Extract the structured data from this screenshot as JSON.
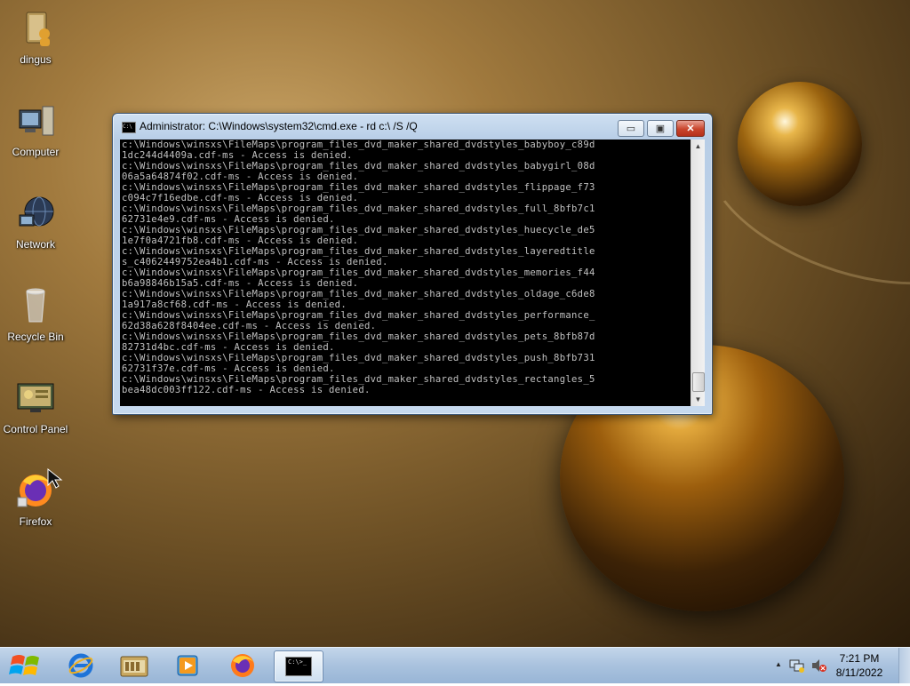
{
  "window": {
    "title": "Administrator: C:\\Windows\\system32\\cmd.exe - rd  c:\\ /S /Q",
    "icon_text": "C:\\",
    "min_symbol": "▭",
    "max_symbol": "▣",
    "close_symbol": "✕"
  },
  "console_lines": [
    "c:\\Windows\\winsxs\\FileMaps\\program_files_dvd_maker_shared_dvdstyles_babyboy_c89d",
    "1dc244d4409a.cdf-ms - Access is denied.",
    "c:\\Windows\\winsxs\\FileMaps\\program_files_dvd_maker_shared_dvdstyles_babygirl_08d",
    "06a5a64874f02.cdf-ms - Access is denied.",
    "c:\\Windows\\winsxs\\FileMaps\\program_files_dvd_maker_shared_dvdstyles_flippage_f73",
    "c094c7f16edbe.cdf-ms - Access is denied.",
    "c:\\Windows\\winsxs\\FileMaps\\program_files_dvd_maker_shared_dvdstyles_full_8bfb7c1",
    "62731e4e9.cdf-ms - Access is denied.",
    "c:\\Windows\\winsxs\\FileMaps\\program_files_dvd_maker_shared_dvdstyles_huecycle_de5",
    "1e7f0a4721fb8.cdf-ms - Access is denied.",
    "c:\\Windows\\winsxs\\FileMaps\\program_files_dvd_maker_shared_dvdstyles_layeredtitle",
    "s_c4062449752ea4b1.cdf-ms - Access is denied.",
    "c:\\Windows\\winsxs\\FileMaps\\program_files_dvd_maker_shared_dvdstyles_memories_f44",
    "b6a98846b15a5.cdf-ms - Access is denied.",
    "c:\\Windows\\winsxs\\FileMaps\\program_files_dvd_maker_shared_dvdstyles_oldage_c6de8",
    "1a917a8cf68.cdf-ms - Access is denied.",
    "c:\\Windows\\winsxs\\FileMaps\\program_files_dvd_maker_shared_dvdstyles_performance_",
    "62d38a628f8404ee.cdf-ms - Access is denied.",
    "c:\\Windows\\winsxs\\FileMaps\\program_files_dvd_maker_shared_dvdstyles_pets_8bfb87d",
    "82731d4bc.cdf-ms - Access is denied.",
    "c:\\Windows\\winsxs\\FileMaps\\program_files_dvd_maker_shared_dvdstyles_push_8bfb731",
    "62731f37e.cdf-ms - Access is denied.",
    "c:\\Windows\\winsxs\\FileMaps\\program_files_dvd_maker_shared_dvdstyles_rectangles_5",
    "bea48dc003ff122.cdf-ms - Access is denied."
  ],
  "desktop_icons": [
    {
      "label": "dingus",
      "icon": "user-folder-icon"
    },
    {
      "label": "Computer",
      "icon": "computer-icon"
    },
    {
      "label": "Network",
      "icon": "network-icon"
    },
    {
      "label": "Recycle Bin",
      "icon": "recycle-bin-icon"
    },
    {
      "label": "Control Panel",
      "icon": "control-panel-icon"
    },
    {
      "label": "Firefox",
      "icon": "firefox-icon"
    }
  ],
  "taskbar": {
    "pinned": [
      {
        "name": "internet-explorer",
        "icon": "internet-explorer-icon"
      },
      {
        "name": "file-explorer",
        "icon": "file-explorer-icon"
      },
      {
        "name": "media-player",
        "icon": "media-player-icon"
      },
      {
        "name": "firefox",
        "icon": "firefox-icon"
      },
      {
        "name": "command-prompt",
        "icon": "cmd-icon",
        "active": true
      }
    ],
    "cmd_icon_text": "C:\\>_",
    "tray_arrow": "▲",
    "clock_time": "7:21 PM",
    "clock_date": "8/11/2022"
  },
  "colors": {
    "console_bg": "#000000",
    "console_fg": "#c0c0c0",
    "taskbar": "#a9c2de",
    "close_button": "#c9452c"
  }
}
